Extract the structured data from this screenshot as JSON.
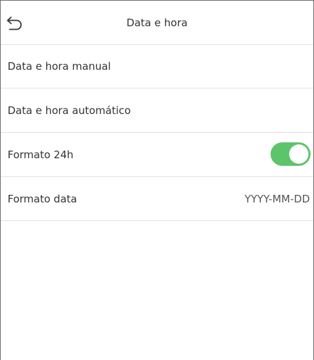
{
  "header": {
    "title": "Data e hora",
    "back_icon": "back-arrow-icon"
  },
  "rows": [
    {
      "label": "Data e hora manual"
    },
    {
      "label": "Data e hora automático"
    },
    {
      "label": "Formato 24h",
      "toggle_on": true
    },
    {
      "label": "Formato data",
      "value": "YYYY-MM-DD"
    }
  ],
  "colors": {
    "toggle_on": "#5cc56b",
    "divider": "#e2e2e2",
    "text": "#333333"
  }
}
